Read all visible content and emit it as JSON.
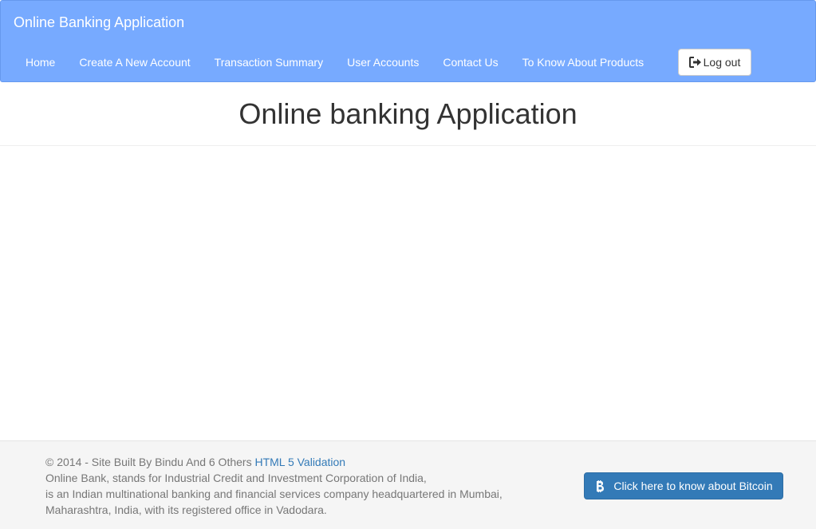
{
  "navbar": {
    "brand": "Online Banking Application",
    "items": [
      {
        "label": "Home"
      },
      {
        "label": "Create A New Account"
      },
      {
        "label": "Transaction Summary"
      },
      {
        "label": "User Accounts"
      },
      {
        "label": "Contact Us"
      },
      {
        "label": "To Know About Products"
      }
    ],
    "logout": {
      "label": "Log out",
      "icon": "sign-out-icon"
    }
  },
  "header": {
    "title": "Online banking Application"
  },
  "footer": {
    "copyright": "© 2014 - Site Built By Bindu And 6 Others",
    "link": "HTML 5 Validation",
    "line1": "Online Bank, stands for Industrial Credit and Investment Corporation of India,",
    "line2": "is an Indian multinational banking and financial services company headquartered in Mumbai,",
    "line3": "Maharashtra, India, with its registered office in Vadodara.",
    "bitcoin_button": {
      "label": "Click here to know about Bitcoin",
      "icon": "bitcoin-icon"
    }
  },
  "colors": {
    "navbar_bg": "#77aaff",
    "primary_button": "#337ab7",
    "footer_bg": "#f5f5f5"
  }
}
